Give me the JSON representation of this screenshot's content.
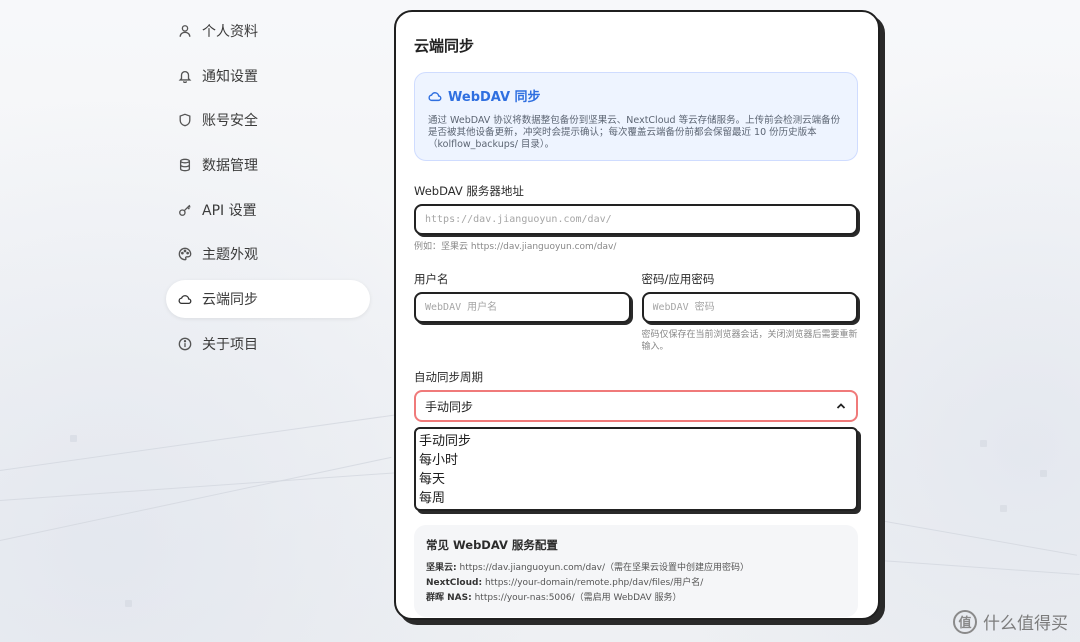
{
  "sidebar": {
    "items": [
      {
        "label": "个人资料",
        "icon": "user-icon"
      },
      {
        "label": "通知设置",
        "icon": "bell-icon"
      },
      {
        "label": "账号安全",
        "icon": "shield-icon"
      },
      {
        "label": "数据管理",
        "icon": "database-icon"
      },
      {
        "label": "API 设置",
        "icon": "key-icon"
      },
      {
        "label": "主题外观",
        "icon": "palette-icon"
      },
      {
        "label": "云端同步",
        "icon": "cloud-icon",
        "active": true
      },
      {
        "label": "关于项目",
        "icon": "info-icon"
      }
    ]
  },
  "panel": {
    "title": "云端同步",
    "info": {
      "title": "WebDAV 同步",
      "description": "通过 WebDAV 协议将数据整包备份到坚果云、NextCloud 等云存储服务。上传前会检测云端备份是否被其他设备更新，冲突时会提示确认；每次覆盖云端备份前都会保留最近 10 份历史版本（kolflow_backups/ 目录）。"
    },
    "server": {
      "label": "WebDAV 服务器地址",
      "placeholder": "https://dav.jianguoyun.com/dav/",
      "hint": "例如：坚果云 https://dav.jianguoyun.com/dav/"
    },
    "username": {
      "label": "用户名",
      "placeholder": "WebDAV 用户名"
    },
    "password": {
      "label": "密码/应用密码",
      "placeholder": "WebDAV 密码",
      "hint": "密码仅保存在当前浏览器会话，关闭浏览器后需要重新输入。"
    },
    "period": {
      "label": "自动同步周期",
      "selected": "手动同步",
      "options": [
        "手动同步",
        "每小时",
        "每天",
        "每周"
      ]
    },
    "common": {
      "title": "常见 WebDAV 服务配置",
      "lines": [
        {
          "name": "坚果云:",
          "value": "https://dav.jianguoyun.com/dav/（需在坚果云设置中创建应用密码）"
        },
        {
          "name": "NextCloud:",
          "value": "https://your-domain/remote.php/dav/files/用户名/"
        },
        {
          "name": "群晖 NAS:",
          "value": "https://your-nas:5006/（需启用 WebDAV 服务）"
        }
      ]
    }
  },
  "watermark": {
    "logo": "值",
    "text": "什么值得买"
  },
  "colors": {
    "accent": "#2f6fe0",
    "select_border": "#f07a7a",
    "panel_border": "#1f1f1f"
  }
}
